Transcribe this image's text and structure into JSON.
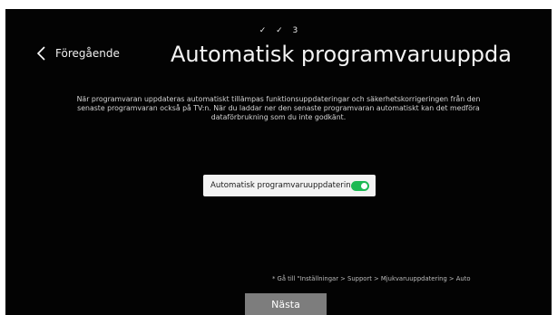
{
  "steps": [
    "✓",
    "✓",
    "3"
  ],
  "back": {
    "label": "Föregående",
    "icon": "chevron-left-icon"
  },
  "title": "Automatisk programvaruuppda",
  "description": "När programvaran uppdateras automatiskt tillämpas funktionsuppdateringar och säkerhetskorrigeringen från den senaste programvaran också på TV:n. När du laddar ner den senaste programvaran automatiskt kan det medföra dataförbrukning som du inte godkänt.",
  "toggle": {
    "label": "Automatisk programvaruuppdaterin",
    "state": "on",
    "on_color": "#1db954"
  },
  "footnote": "* Gå till \"Inställningar > Support > Mjukvaruuppdatering > Auto",
  "next_button": {
    "label": "Nästa"
  },
  "colors": {
    "background": "#030303",
    "button": "#7d7d7d"
  }
}
